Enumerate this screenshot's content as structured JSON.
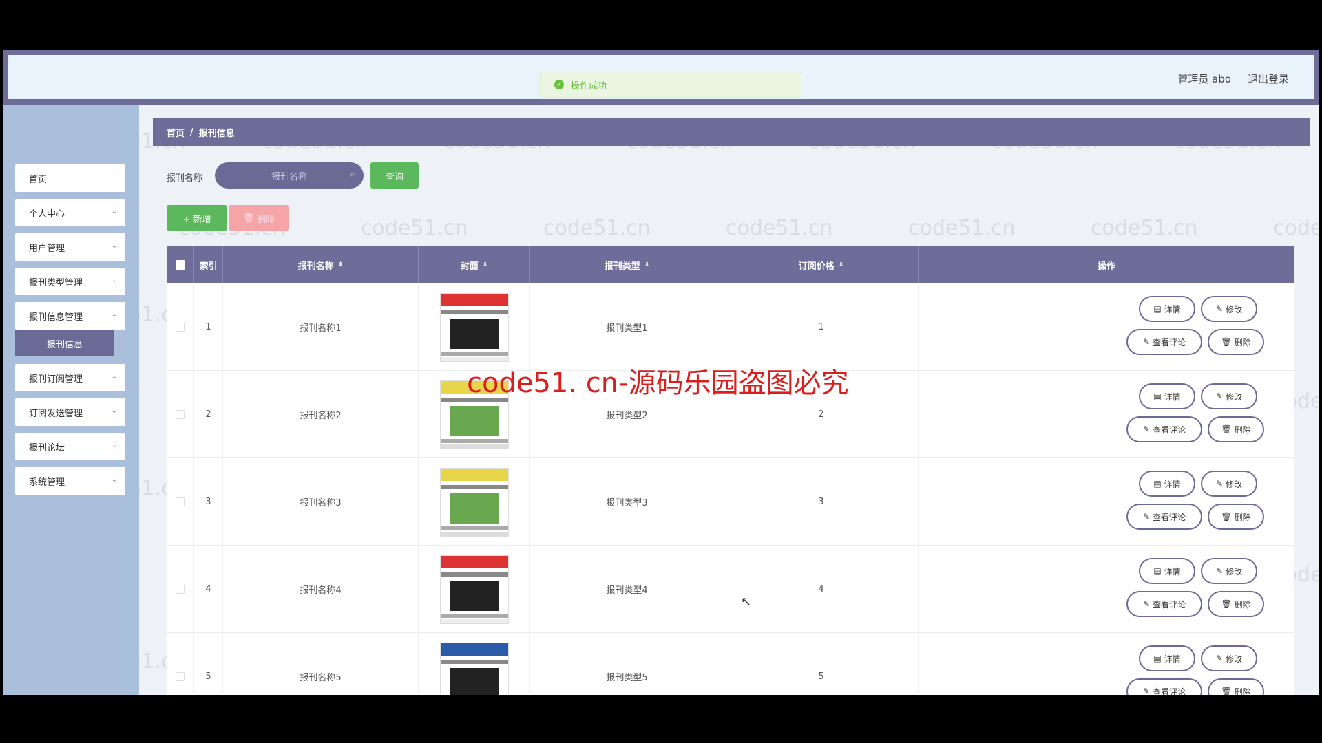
{
  "topbar": {
    "toast": "操作成功",
    "user": "管理员 abo",
    "logout": "退出登录"
  },
  "sidebar": {
    "items": [
      {
        "label": "首页"
      },
      {
        "label": "个人中心"
      },
      {
        "label": "用户管理"
      },
      {
        "label": "报刊类型管理"
      },
      {
        "label": "报刊信息管理"
      },
      {
        "label": "报刊订阅管理"
      },
      {
        "label": "订阅发送管理"
      },
      {
        "label": "报刊论坛"
      },
      {
        "label": "系统管理"
      }
    ],
    "active_sub": "报刊信息"
  },
  "breadcrumb": {
    "home": "首页",
    "sep": "/",
    "current": "报刊信息"
  },
  "search": {
    "label": "报刊名称",
    "placeholder": "报刊名称",
    "query_button": "查询"
  },
  "actions": {
    "add": "+ 新增",
    "delete": "删除"
  },
  "table": {
    "headers": [
      "索引",
      "报刊名称",
      "封面",
      "报刊类型",
      "订阅价格",
      "操作"
    ],
    "rows": [
      {
        "index": "1",
        "name": "报刊名称1",
        "type": "报刊类型1",
        "price": "1"
      },
      {
        "index": "2",
        "name": "报刊名称2",
        "type": "报刊类型2",
        "price": "2"
      },
      {
        "index": "3",
        "name": "报刊名称3",
        "type": "报刊类型3",
        "price": "3"
      },
      {
        "index": "4",
        "name": "报刊名称4",
        "type": "报刊类型4",
        "price": "4"
      },
      {
        "index": "5",
        "name": "报刊名称5",
        "type": "报刊类型5",
        "price": "5"
      }
    ],
    "op_labels": {
      "detail": "详情",
      "edit": "修改",
      "comments": "查看评论",
      "delete": "删除"
    }
  },
  "overlay": {
    "banner": "code51. cn-源码乐园盗图必究",
    "watermark": "code51.cn"
  }
}
